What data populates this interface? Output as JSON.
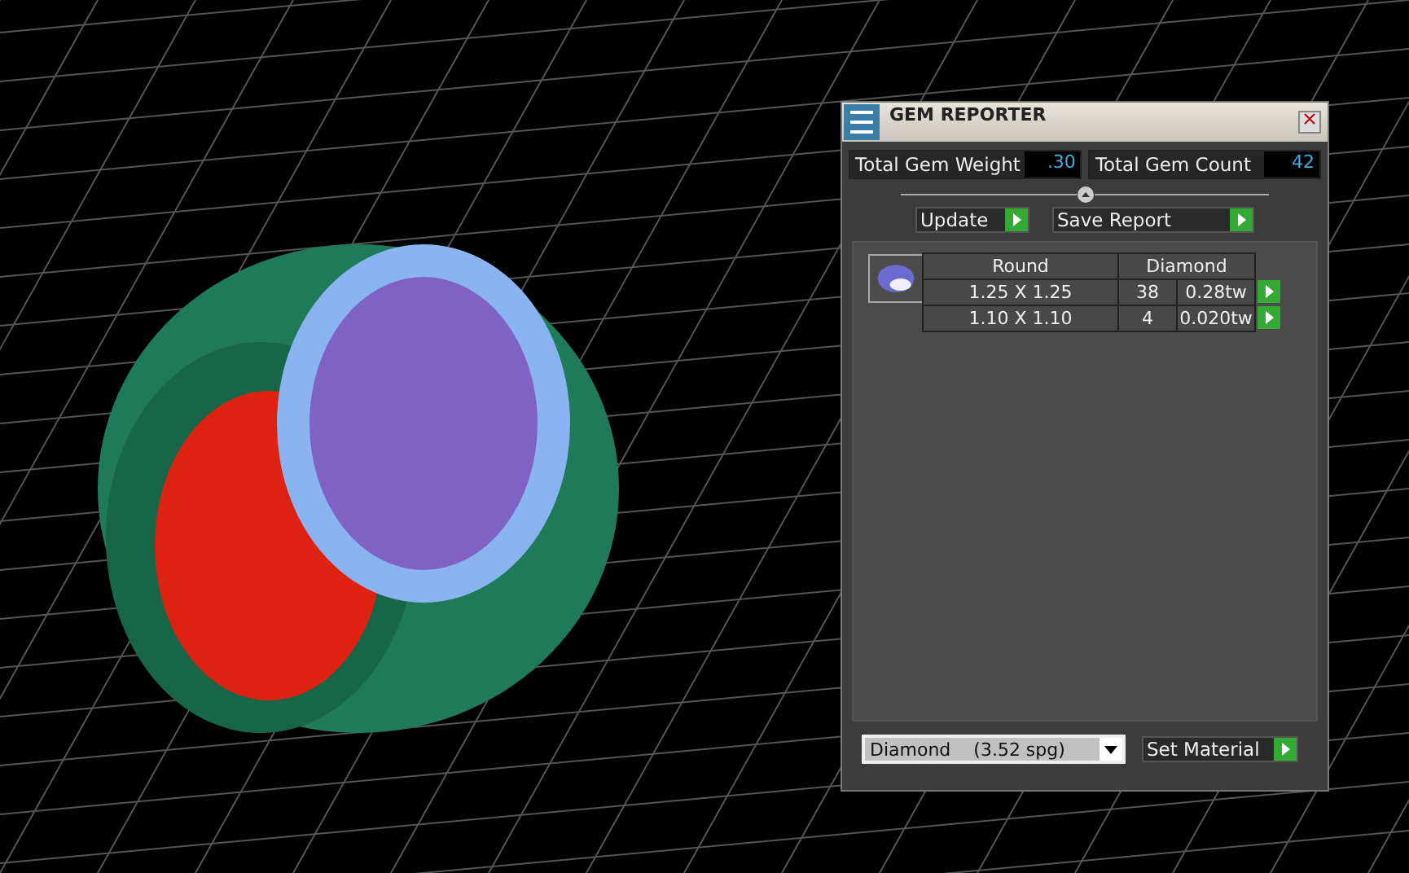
{
  "window": {
    "title": "GEM REPORTER"
  },
  "totals": [
    {
      "label": "Total Gem Weight",
      "value": ".30"
    },
    {
      "label": "Total Gem Count",
      "value": "42"
    }
  ],
  "actions": [
    {
      "label": "Update",
      "kind": "short"
    },
    {
      "label": "Save Report",
      "kind": "wide"
    }
  ],
  "table": {
    "columns": [
      "Round",
      "Diamond"
    ],
    "rows": [
      {
        "size": "1.25 X 1.25",
        "count": "38",
        "weight": "0.28tw"
      },
      {
        "size": "1.10 X 1.10",
        "count": "4",
        "weight": "0.020tw"
      }
    ]
  },
  "material": {
    "value": "Diamond    (3.52 spg)",
    "button": "Set Material"
  }
}
